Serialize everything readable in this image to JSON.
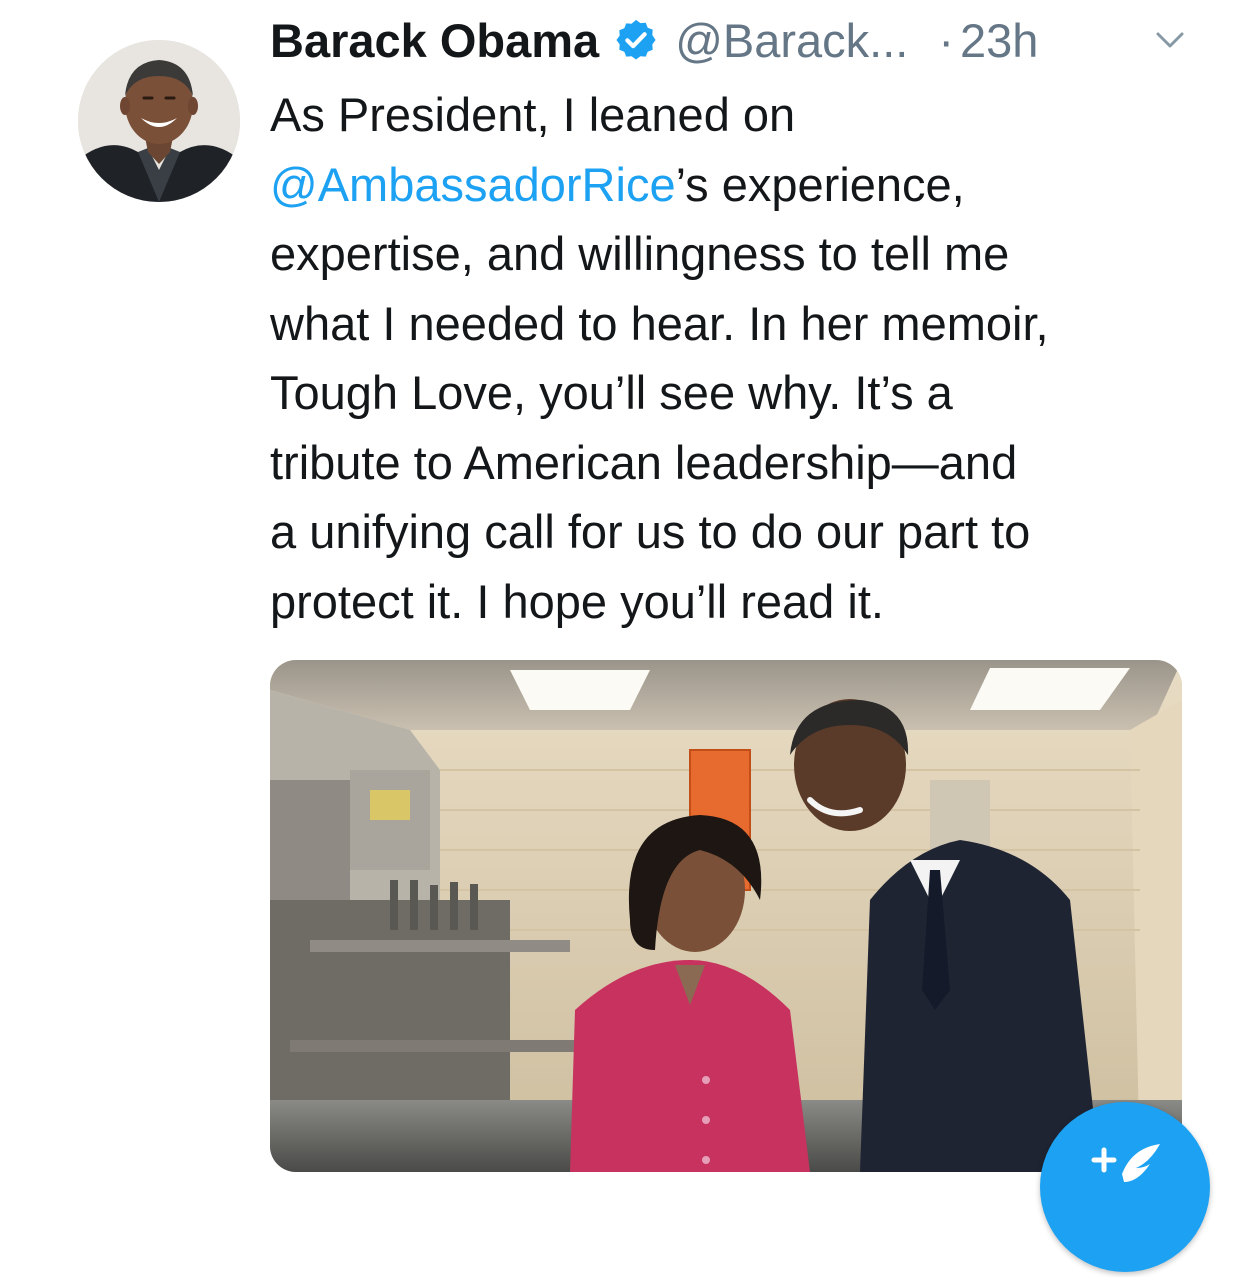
{
  "tweet": {
    "author_name": "Barack Obama",
    "handle": "@Barack...",
    "separator": "·",
    "time": "23h",
    "text_lines": [
      {
        "before": "As President, I leaned on",
        "mention": "",
        "after": ""
      },
      {
        "before": "",
        "mention": "@AmbassadorRice",
        "after": "’s experience,"
      },
      {
        "before": "expertise, and willingness to tell me",
        "mention": "",
        "after": ""
      },
      {
        "before": "what I needed to hear. In her memoir,",
        "mention": "",
        "after": ""
      },
      {
        "before": "Tough Love, you’ll see why. It’s a",
        "mention": "",
        "after": ""
      },
      {
        "before": "tribute to American leadership—and",
        "mention": "",
        "after": ""
      },
      {
        "before": "a unifying call for us to do our part to",
        "mention": "",
        "after": ""
      },
      {
        "before": "protect it. I hope you’ll read it.",
        "mention": "",
        "after": ""
      }
    ]
  },
  "icons": {
    "verified": "verified-badge-icon",
    "caret": "chevron-down-icon",
    "compose": "compose-tweet-icon"
  },
  "colors": {
    "link": "#1da1f2",
    "secondary_text": "#657786",
    "primary_text": "#14171a",
    "fab": "#1da1f2"
  }
}
